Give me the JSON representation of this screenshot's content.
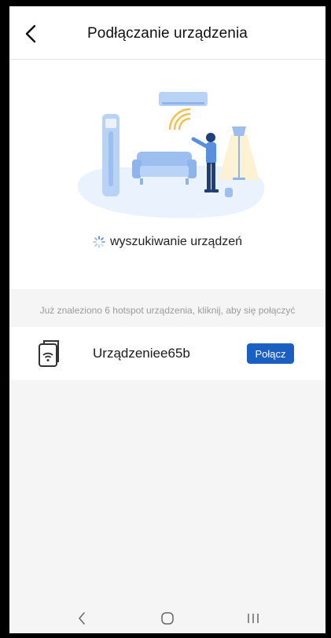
{
  "header": {
    "title": "Podłączanie urządzenia"
  },
  "status": {
    "text": "wyszukiwanie urządzeń"
  },
  "found": {
    "text": "Już znaleziono 6 hotspot urządzenia, kliknij, aby się połączyć"
  },
  "devices": [
    {
      "name": "Urządzeniee65b",
      "button_label": "Połącz",
      "icon": "wifi-device-icon"
    }
  ],
  "colors": {
    "accent": "#1b5fc1",
    "illustration_blue": "#a9c8f5",
    "background_grey": "#f5f5f6"
  },
  "nav": {
    "back_icon": "chevron-left-icon",
    "home_icon": "home-icon",
    "recents_icon": "recents-icon"
  }
}
